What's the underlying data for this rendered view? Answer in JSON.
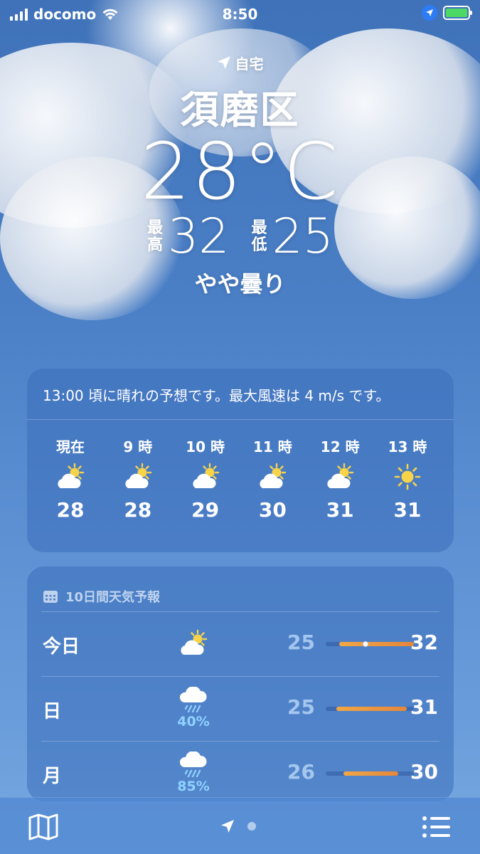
{
  "status_bar": {
    "carrier": "docomo",
    "time": "8:50"
  },
  "header": {
    "location_label": "自宅",
    "city": "須磨区",
    "temperature": "28°C",
    "high_label": "最高",
    "high": "32",
    "low_label": "最低",
    "low": "25",
    "condition": "やや曇り"
  },
  "hourly": {
    "summary": "13:00 頃に晴れの予想です。最大風速は 4 m/s です。",
    "items": [
      {
        "time": "現在",
        "icon": "partly-sunny-icon",
        "temp": "28"
      },
      {
        "time": "9 時",
        "icon": "partly-sunny-icon",
        "temp": "28"
      },
      {
        "time": "10 時",
        "icon": "partly-sunny-icon",
        "temp": "29"
      },
      {
        "time": "11 時",
        "icon": "partly-sunny-icon",
        "temp": "30"
      },
      {
        "time": "12 時",
        "icon": "partly-sunny-icon",
        "temp": "31"
      },
      {
        "time": "13 時",
        "icon": "sun-icon",
        "temp": "31"
      }
    ]
  },
  "daily": {
    "title": "10日間天気予報",
    "days": [
      {
        "name": "今日",
        "icon": "partly-sunny-icon",
        "precip": "",
        "low": "25",
        "high": "32",
        "bar_start": 0.15,
        "bar_end": 1.0,
        "current": 0.45
      },
      {
        "name": "日",
        "icon": "rain-icon",
        "precip": "40%",
        "low": "25",
        "high": "31",
        "bar_start": 0.12,
        "bar_end": 0.92
      },
      {
        "name": "月",
        "icon": "rain-icon",
        "precip": "85%",
        "low": "26",
        "high": "30",
        "bar_start": 0.2,
        "bar_end": 0.82
      }
    ]
  },
  "colors": {
    "bar_warm": "#e5863a",
    "precip_text": "#8fd2ff",
    "location_badge": "#2d7cf6",
    "battery_fill": "#4cd964"
  }
}
